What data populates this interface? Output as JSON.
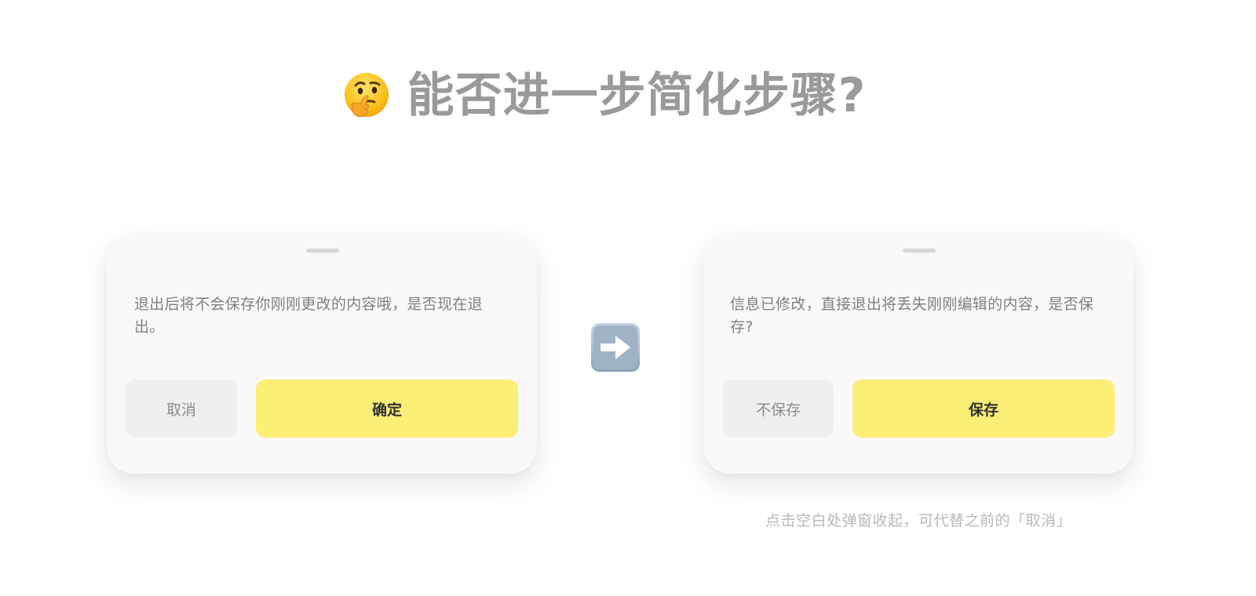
{
  "title": {
    "emoji": "thinking-face",
    "text": "能否进一步简化步骤?"
  },
  "dialog_before": {
    "message": "退出后将不会保存你刚刚更改的内容哦，是否现在退出。",
    "cancel_label": "取消",
    "confirm_label": "确定"
  },
  "arrow_icon": "right-arrow-icon",
  "dialog_after": {
    "message": "信息已修改，直接退出将丢失刚刚编辑的内容，是否保存?",
    "discard_label": "不保存",
    "save_label": "保存"
  },
  "note": "点击空白处弹窗收起，可代替之前的「取消」",
  "colors": {
    "primary_button": "#fdee75",
    "secondary_button": "#efefef",
    "card_background": "#f9f9f9",
    "title_text": "#9a9a9a"
  }
}
